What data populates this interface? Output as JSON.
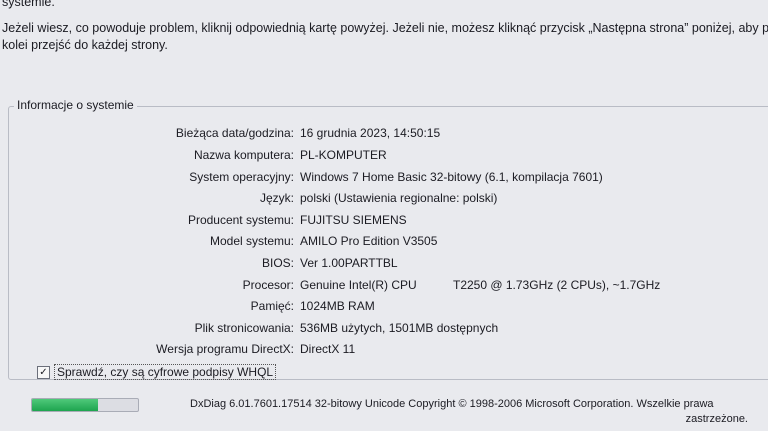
{
  "intro": {
    "line0": "systemie.",
    "line1": "Jeżeli wiesz, co powoduje problem, kliknij odpowiednią kartę powyżej. Jeżeli nie, możesz kliknąć przycisk „Następna strona” poniżej, aby po",
    "line2": "kolei przejść do każdej strony."
  },
  "system_info": {
    "group_label": "Informacje o systemie",
    "rows": [
      {
        "label": "Bieżąca data/godzina:",
        "value": "16 grudnia 2023, 14:50:15"
      },
      {
        "label": "Nazwa komputera:",
        "value": "PL-KOMPUTER"
      },
      {
        "label": "System operacyjny:",
        "value": "Windows 7 Home Basic 32-bitowy (6.1, kompilacja 7601)"
      },
      {
        "label": "Język:",
        "value": "polski (Ustawienia regionalne: polski)"
      },
      {
        "label": "Producent systemu:",
        "value": "FUJITSU SIEMENS"
      },
      {
        "label": "Model systemu:",
        "value": "AMILO Pro Edition V3505"
      },
      {
        "label": "BIOS:",
        "value": "Ver 1.00PARTTBL"
      },
      {
        "label": "Procesor:",
        "value": "Genuine Intel(R) CPU",
        "value2": "T2250  @ 1.73GHz (2 CPUs), ~1.7GHz"
      },
      {
        "label": "Pamięć:",
        "value": "1024MB RAM"
      },
      {
        "label": "Plik stronicowania:",
        "value": "536MB użytych, 1501MB dostępnych"
      },
      {
        "label": "Wersja programu DirectX:",
        "value": "DirectX 11"
      }
    ]
  },
  "whql": {
    "checked": true,
    "check_glyph": "✓",
    "label": "Sprawdź, czy są cyfrowe podpisy WHQL"
  },
  "progress": {
    "fraction": 0.62,
    "color": "#1ea44f"
  },
  "footer": {
    "line1": "DxDiag 6.01.7601.17514 32-bitowy Unicode  Copyright © 1998-2006 Microsoft Corporation.  Wszelkie prawa",
    "line2": "zastrzeżone."
  }
}
